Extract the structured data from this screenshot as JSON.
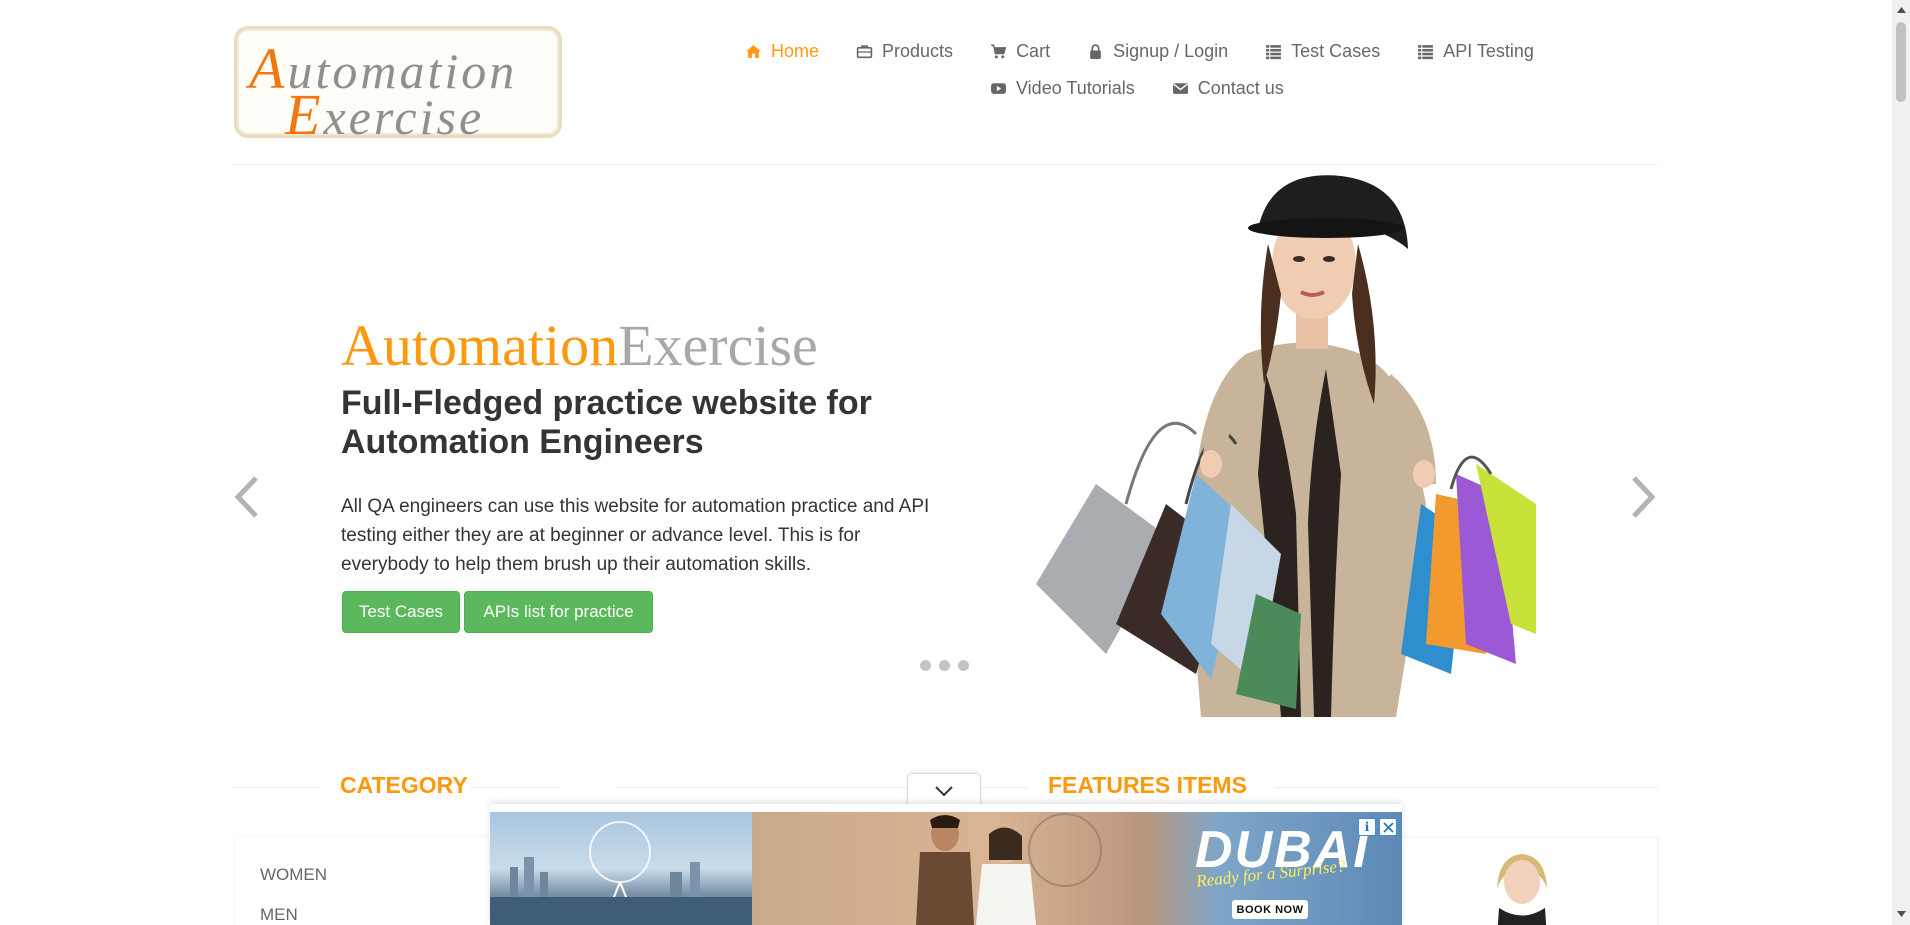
{
  "header": {
    "logo_text_line1": "Automation",
    "logo_text_line2": "Exercise"
  },
  "nav": {
    "items": [
      {
        "label": "Home",
        "icon": "home-icon"
      },
      {
        "label": "Products",
        "icon": "briefcase-icon"
      },
      {
        "label": "Cart",
        "icon": "cart-icon"
      },
      {
        "label": "Signup / Login",
        "icon": "lock-icon"
      },
      {
        "label": "Test Cases",
        "icon": "list-icon"
      },
      {
        "label": "API Testing",
        "icon": "list-icon"
      },
      {
        "label": "Video Tutorials",
        "icon": "youtube-icon"
      },
      {
        "label": "Contact us",
        "icon": "envelope-icon"
      }
    ],
    "active": "Home"
  },
  "hero": {
    "title_part1": "Automation",
    "title_part2": "Exercise",
    "heading": "Full-Fledged practice website for Automation Engineers",
    "text": "All QA engineers can use this website for automation practice and API testing either they are at beginner or advance level. This is for everybody to help them brush up their automation skills.",
    "buttons": {
      "test_cases": "Test Cases",
      "apis": "APIs list for practice"
    },
    "slide_count": 3
  },
  "sections": {
    "category_title": "CATEGORY",
    "features_title": "FEATURES ITEMS",
    "categories": [
      "WOMEN",
      "MEN"
    ]
  },
  "ad": {
    "headline": "DUBAI",
    "tagline": "Ready for a Surprise?",
    "cta": "BOOK NOW",
    "info_glyph": "i"
  },
  "colors": {
    "accent": "#fe980f",
    "text": "#696763",
    "dark_text": "#363432",
    "button_green": "#5cb85c"
  }
}
